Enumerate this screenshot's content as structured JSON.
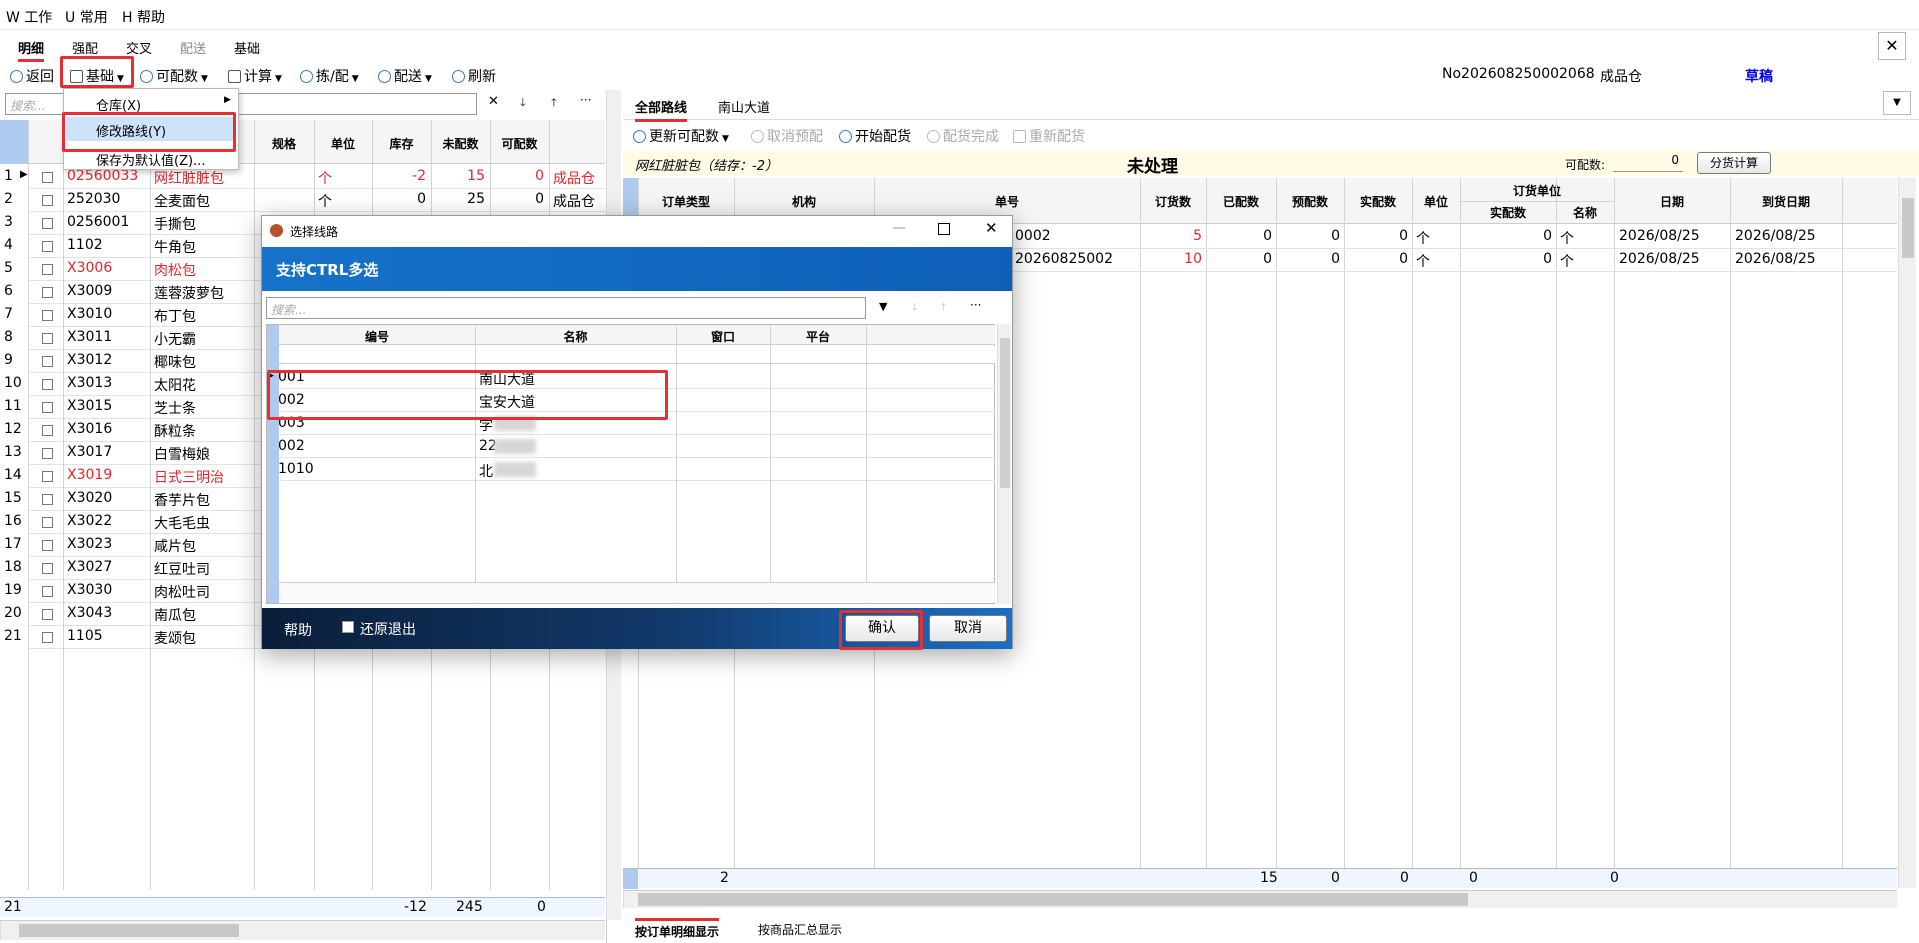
{
  "menu": {
    "work": "W 工作",
    "common": "U 常用",
    "help": "H 帮助"
  },
  "tabs": [
    "明细",
    "强配",
    "交叉",
    "配送",
    "基础"
  ],
  "toolbar": {
    "back": "返回",
    "basic": "基础",
    "available": "可配数",
    "calc": "计算",
    "pick": "拣/配",
    "deliver": "配送",
    "refresh": "刷新"
  },
  "header_info": {
    "no": "No202608250002068",
    "warehouse": "成品仓",
    "status": "草稿"
  },
  "dropdown": {
    "warehouse": "仓库(X)",
    "modify_route": "修改路线(Y)",
    "save_default": "保存为默认值(Z)..."
  },
  "left_panel": {
    "search_placeholder": "搜索...",
    "columns": [
      "规格",
      "单位",
      "库存",
      "未配数",
      "可配数"
    ],
    "rows": [
      {
        "n": "1",
        "code": "02560033",
        "name": "网红脏脏包",
        "unit": "个",
        "stock": "-2",
        "unalloc": "15",
        "avail": "0",
        "wh": "成品仓",
        "red": true
      },
      {
        "n": "2",
        "code": "252030",
        "name": "全麦面包",
        "unit": "个",
        "stock": "0",
        "unalloc": "25",
        "avail": "0",
        "wh": "成品仓",
        "red": false
      },
      {
        "n": "3",
        "code": "0256001",
        "name": "手撕包",
        "red": false
      },
      {
        "n": "4",
        "code": "1102",
        "name": "牛角包",
        "red": false
      },
      {
        "n": "5",
        "code": "X3006",
        "name": "肉松包",
        "red": true
      },
      {
        "n": "6",
        "code": "X3009",
        "name": "莲蓉菠萝包",
        "red": false
      },
      {
        "n": "7",
        "code": "X3010",
        "name": "布丁包",
        "red": false
      },
      {
        "n": "8",
        "code": "X3011",
        "name": "小无霸",
        "red": false
      },
      {
        "n": "9",
        "code": "X3012",
        "name": "椰味包",
        "red": false
      },
      {
        "n": "10",
        "code": "X3013",
        "name": "太阳花",
        "red": false
      },
      {
        "n": "11",
        "code": "X3015",
        "name": "芝士条",
        "red": false
      },
      {
        "n": "12",
        "code": "X3016",
        "name": "酥粒条",
        "red": false
      },
      {
        "n": "13",
        "code": "X3017",
        "name": "白雪梅娘",
        "red": false
      },
      {
        "n": "14",
        "code": "X3019",
        "name": "日式三明治",
        "red": true
      },
      {
        "n": "15",
        "code": "X3020",
        "name": "香芋片包",
        "red": false
      },
      {
        "n": "16",
        "code": "X3022",
        "name": "大毛毛虫",
        "red": false
      },
      {
        "n": "17",
        "code": "X3023",
        "name": "咸片包",
        "red": false
      },
      {
        "n": "18",
        "code": "X3027",
        "name": "红豆吐司",
        "red": false
      },
      {
        "n": "19",
        "code": "X3030",
        "name": "肉松吐司",
        "red": false
      },
      {
        "n": "20",
        "code": "X3043",
        "name": "南瓜包",
        "red": false
      },
      {
        "n": "21",
        "code": "1105",
        "name": "麦颂包",
        "red": false
      }
    ],
    "footer": {
      "count": "21",
      "stock": "-12",
      "unalloc": "245",
      "avail": "0"
    }
  },
  "right_panel": {
    "route_tabs": [
      "全部路线",
      "南山大道"
    ],
    "actions": {
      "update": "更新可配数",
      "cancel_pre": "取消预配",
      "start": "开始配货",
      "done": "配货完成",
      "redo": "重新配货"
    },
    "product_title": "网红脏脏包（结存：-2）",
    "state": "未处理",
    "avail_label": "可配数:",
    "avail_value": "0",
    "split_btn": "分货计算",
    "columns": {
      "type": "订单类型",
      "org": "机构",
      "order": "单号",
      "qty": "订货数",
      "allocated": "已配数",
      "pre": "预配数",
      "actual": "实配数",
      "unit": "单位",
      "order_unit": "订货单位",
      "actual2": "实配数",
      "name": "名称",
      "date": "日期",
      "arrive": "到货日期"
    },
    "rows": [
      {
        "order": "0002",
        "qty": "5",
        "allocated": "0",
        "pre": "0",
        "actual": "0",
        "unit": "个",
        "actual2": "0",
        "name": "个",
        "date": "2026/08/25",
        "arrive": "2026/08/25"
      },
      {
        "order": "20260825002",
        "qty": "10",
        "allocated": "0",
        "pre": "0",
        "actual": "0",
        "unit": "个",
        "actual2": "0",
        "name": "个",
        "date": "2026/08/25",
        "arrive": "2026/08/25"
      }
    ],
    "footer": {
      "count": "2",
      "qty": "15",
      "allocated": "0",
      "pre": "0",
      "actual": "0",
      "actual2": "0"
    },
    "bottom_tabs": [
      "按订单明细显示",
      "按商品汇总显示"
    ]
  },
  "dialog": {
    "title": "选择线路",
    "banner": "支持CTRL多选",
    "search_placeholder": "搜索...",
    "columns": [
      "编号",
      "名称",
      "窗口",
      "平台"
    ],
    "rows": [
      {
        "code": "001",
        "name": "南山大道"
      },
      {
        "code": "002",
        "name": "宝安大道"
      },
      {
        "code": "003",
        "name": "学"
      },
      {
        "code": "002",
        "name": "22"
      },
      {
        "code": "1010",
        "name": "北"
      }
    ],
    "help": "帮助",
    "restore_exit": "还原退出",
    "confirm": "确认",
    "cancel": "取消"
  }
}
